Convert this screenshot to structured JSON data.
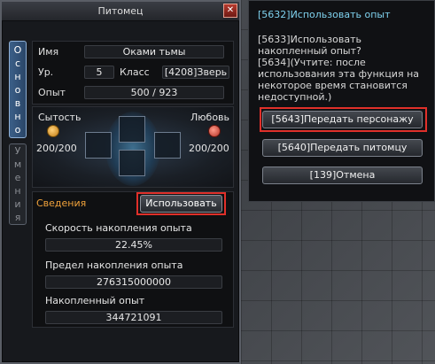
{
  "pet_window": {
    "title": "Питомец",
    "close_glyph": "✕",
    "tabs": {
      "main": "Основно",
      "skills": "Умения"
    },
    "info": {
      "name_label": "Имя",
      "name_value": "Оками тьмы",
      "level_label": "Ур.",
      "level_value": "5",
      "class_label": "Класс",
      "class_value": "[4208]Зверь",
      "exp_label": "Опыт",
      "exp_value": "500 / 923"
    },
    "stats": {
      "satiety_label": "Сытость",
      "satiety_value": "200/200",
      "love_label": "Любовь",
      "love_value": "200/200"
    },
    "details": {
      "heading": "Сведения",
      "use_button": "Использовать",
      "rate_label": "Скорость накопления опыта",
      "rate_value": "22.45%",
      "limit_label": "Предел накопления опыта",
      "limit_value": "276315000000",
      "accum_label": "Накопленный опыт",
      "accum_value": "344721091"
    }
  },
  "dialog": {
    "title": "[5632]Использовать опыт",
    "body": "[5633]Использовать накопленный опыт?\n[5634](Учтите: после использования эта функция на некоторое время становится недоступной.)",
    "buttons": {
      "transfer_character": "[5643]Передать персонажу",
      "transfer_pet": "[5640]Передать питомцу",
      "cancel": "[139]Отмена"
    }
  },
  "colors": {
    "highlight": "#e0302a",
    "details_heading": "#f0a23b",
    "dialog_title": "#7fd2ef",
    "active_tab": "#3b5f88"
  },
  "icons": {
    "close": "close-icon",
    "satiety": "satiety-icon",
    "love": "heart-icon",
    "crest": "pet-crest-icon"
  }
}
